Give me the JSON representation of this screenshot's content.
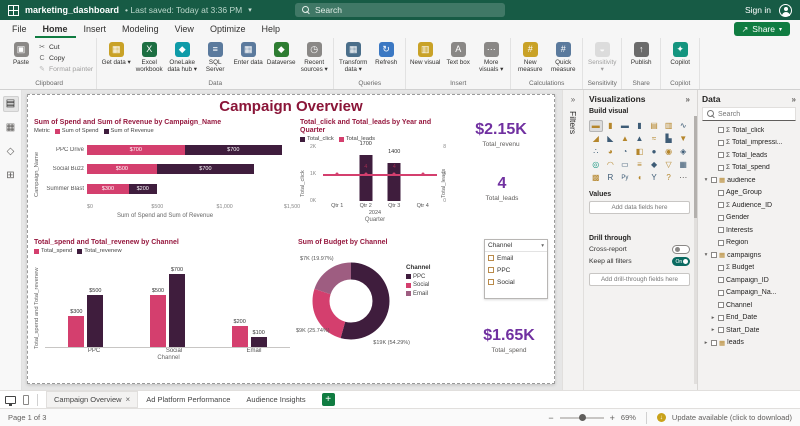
{
  "colors": {
    "titlebar_green": "#175b45",
    "brand_green": "#107c41",
    "accent_dark": "#3f1d3d",
    "accent_pink": "#d43f6e",
    "accent_mauve": "#9e5d81",
    "title_maroon": "#8a1538",
    "chart_title_maroon": "#96193f",
    "card_purple": "#7030a0",
    "toggle_on_teal": "#0a6a61"
  },
  "titlebar": {
    "doc_title": "marketing_dashboard",
    "saved_text": "• Last saved: Today at 3:36 PM",
    "search_placeholder": "Search",
    "sign_in": "Sign in"
  },
  "menubar": {
    "tabs": [
      "File",
      "Home",
      "Insert",
      "Modeling",
      "View",
      "Optimize",
      "Help"
    ],
    "active_tab": "Home",
    "share_label": "Share"
  },
  "ribbon": {
    "groups": [
      {
        "label": "Clipboard",
        "layout": "clipboard",
        "big": {
          "label": "Paste",
          "glyph": "▣",
          "bg": "#8a8886"
        },
        "small": [
          {
            "label": "Cut",
            "glyph": "✂"
          },
          {
            "label": "Copy",
            "glyph": "C"
          },
          {
            "label": "Format painter",
            "glyph": "✎",
            "disabled": true
          }
        ]
      },
      {
        "label": "Data",
        "buttons": [
          {
            "label": "Get data",
            "caret": true,
            "glyph": "▦",
            "bg": "#c9a227"
          },
          {
            "label": "Excel workbook",
            "glyph": "X",
            "bg": "#1d6f42"
          },
          {
            "label": "OneLake data hub",
            "caret": true,
            "glyph": "◆",
            "bg": "#0f9ba8"
          },
          {
            "label": "SQL Server",
            "glyph": "≡",
            "bg": "#5b7a9d"
          },
          {
            "label": "Enter data",
            "glyph": "▦",
            "bg": "#5b7a9d"
          },
          {
            "label": "Dataverse",
            "glyph": "◆",
            "bg": "#2e7d32"
          },
          {
            "label": "Recent sources",
            "caret": true,
            "glyph": "◷",
            "bg": "#8a8886"
          }
        ]
      },
      {
        "label": "Queries",
        "buttons": [
          {
            "label": "Transform data",
            "caret": true,
            "glyph": "▦",
            "bg": "#4a6e8a"
          },
          {
            "label": "Refresh",
            "glyph": "↻",
            "bg": "#3b78c3"
          }
        ]
      },
      {
        "label": "Insert",
        "buttons": [
          {
            "label": "New visual",
            "glyph": "▥",
            "bg": "#c9a227"
          },
          {
            "label": "Text box",
            "glyph": "A",
            "bg": "#8a8886"
          },
          {
            "label": "More visuals",
            "caret": true,
            "glyph": "⋯",
            "bg": "#8a8886"
          }
        ]
      },
      {
        "label": "Calculations",
        "buttons": [
          {
            "label": "New measure",
            "glyph": "#",
            "bg": "#c9a227"
          },
          {
            "label": "Quick measure",
            "glyph": "#",
            "bg": "#5b7a9d"
          }
        ]
      },
      {
        "label": "Sensitivity",
        "buttons": [
          {
            "label": "Sensitivity",
            "caret": true,
            "disabled": true,
            "glyph": "◒",
            "bg": "#bdbdbd"
          }
        ]
      },
      {
        "label": "Share",
        "buttons": [
          {
            "label": "Publish",
            "glyph": "↑",
            "bg": "#6b6b6b"
          }
        ]
      },
      {
        "label": "Copilot",
        "buttons": [
          {
            "label": "Copilot",
            "glyph": "✦",
            "bg": "#14957f"
          }
        ]
      }
    ]
  },
  "left_rail": {
    "items": [
      {
        "name": "report-view",
        "glyph": "▤",
        "active": true
      },
      {
        "name": "table-view",
        "glyph": "▦",
        "active": false
      },
      {
        "name": "model-view",
        "glyph": "◇",
        "active": false
      },
      {
        "name": "dax-query-view",
        "glyph": "⊞",
        "active": false
      }
    ]
  },
  "report": {
    "page_title": "Campaign Overview",
    "cards": [
      {
        "value": "$2.15K",
        "label": "Total_revenu"
      },
      {
        "value": "4",
        "label": "Total_leads"
      },
      {
        "value": "$1.65K",
        "label": "Total_spend"
      }
    ],
    "slicer": {
      "title": "Channel",
      "items": [
        "Email",
        "PPC",
        "Social"
      ]
    }
  },
  "chart_data": [
    {
      "type": "bar",
      "variant": "horizontal-stacked",
      "title": "Sum of Spend and Sum of Revenue by Campaign_Name",
      "legend_title": "Metric",
      "categories": [
        "PPC Drive",
        "Social Buzz",
        "Summer Blast"
      ],
      "series": [
        {
          "name": "Sum of Spend",
          "color": "#d43f6e",
          "values": [
            700,
            500,
            300
          ]
        },
        {
          "name": "Sum of Revenue",
          "color": "#3f1d3d",
          "values": [
            700,
            700,
            200
          ]
        }
      ],
      "value_labels": [
        [
          "$700",
          "$700"
        ],
        [
          "$500",
          "$700"
        ],
        [
          "$300",
          "$200"
        ]
      ],
      "xlabel": "Sum of Spend and Sum of Revenue",
      "ylabel": "Campaign_Name",
      "xlim": [
        0,
        1500
      ],
      "xticks": [
        "$0",
        "$500",
        "$1,000",
        "$1,500"
      ]
    },
    {
      "type": "line",
      "variant": "column-line-combo",
      "title": "Total_click and Total_leads by Year and Quarter",
      "categories": [
        "Qtr 1",
        "Qtr 2",
        "Qtr 3",
        "Qtr 4"
      ],
      "year_label": "2024",
      "xlabel": "Quarter",
      "series": [
        {
          "name": "Total_click",
          "kind": "column",
          "color": "#3f1d3d",
          "values": [
            null,
            1700,
            1400,
            null
          ],
          "labels": [
            "",
            "1700",
            "1400",
            ""
          ]
        },
        {
          "name": "Total_leads",
          "kind": "line",
          "color": "#d43f6e",
          "values": [
            4,
            4,
            4,
            4
          ],
          "labels": [
            "",
            "4",
            "4",
            ""
          ]
        }
      ],
      "ylabel_left": "Total_click",
      "ylabel_right": "Total_leads",
      "ylim_left": [
        0,
        2000
      ],
      "ylim_right": [
        0,
        8
      ],
      "yticks_left": [
        "2K",
        "1K",
        "0K"
      ],
      "yticks_right": [
        "8",
        "4",
        "0"
      ]
    },
    {
      "type": "bar",
      "variant": "column-clustered",
      "title": "Total_spend and Total_revenew by Channel",
      "categories": [
        "PPC",
        "Social",
        "Email"
      ],
      "series": [
        {
          "name": "Total_spend",
          "color": "#d43f6e",
          "values": [
            300,
            500,
            200
          ]
        },
        {
          "name": "Total_revenew",
          "color": "#3f1d3d",
          "values": [
            500,
            700,
            100
          ]
        }
      ],
      "value_labels": [
        [
          "$300",
          "$500"
        ],
        [
          "$500",
          "$700"
        ],
        [
          "$200",
          "$100"
        ]
      ],
      "xlabel": "Channel",
      "ylabel": "Total_spend and Total_revenew",
      "ylim": [
        0,
        800
      ]
    },
    {
      "type": "pie",
      "variant": "donut",
      "title": "Sum of Budget by Channel",
      "legend_title": "Channel",
      "slices": [
        {
          "name": "PPC",
          "value": 19000,
          "label": "$19K",
          "pct": "54.29%",
          "color": "#3f1d3d"
        },
        {
          "name": "Social",
          "value": 9000,
          "label": "$9K",
          "pct": "25.74%",
          "color": "#d43f6e"
        },
        {
          "name": "Email",
          "value": 7000,
          "label": "$7K",
          "pct": "19.97%",
          "color": "#9e5d81"
        }
      ]
    }
  ],
  "filters_panel": {
    "title": "Filters"
  },
  "viz_panel": {
    "title": "Visualizations",
    "build_visual": "Build visual",
    "values_label": "Values",
    "add_fields_placeholder": "Add data fields here",
    "drill_through": "Drill through",
    "cross_report": "Cross-report",
    "keep_filters": "Keep all filters",
    "toggle_on_label": "On",
    "add_drill_placeholder": "Add drill-through fields here",
    "visual_icons": [
      {
        "name": "stacked-bar-chart",
        "glyph": "▬",
        "color": "#b5862b",
        "selected": true
      },
      {
        "name": "stacked-column-chart",
        "glyph": "▮",
        "color": "#b5862b"
      },
      {
        "name": "clustered-bar-chart",
        "glyph": "▬",
        "color": "#3e5c76"
      },
      {
        "name": "clustered-column-chart",
        "glyph": "▮",
        "color": "#3e5c76"
      },
      {
        "name": "100-stacked-bar-chart",
        "glyph": "▤",
        "color": "#b5862b"
      },
      {
        "name": "100-stacked-column-chart",
        "glyph": "▥",
        "color": "#b5862b"
      },
      {
        "name": "line-chart",
        "glyph": "∿",
        "color": "#3e5c76"
      },
      {
        "name": "area-chart",
        "glyph": "◢",
        "color": "#b5862b"
      },
      {
        "name": "stacked-area-chart",
        "glyph": "◣",
        "color": "#3e5c76"
      },
      {
        "name": "line-and-stacked-column-chart",
        "glyph": "▲",
        "color": "#b5862b"
      },
      {
        "name": "line-and-clustered-column-chart",
        "glyph": "▲",
        "color": "#3e5c76"
      },
      {
        "name": "ribbon-chart",
        "glyph": "≈",
        "color": "#b5862b"
      },
      {
        "name": "waterfall-chart",
        "glyph": "▙",
        "color": "#3e5c76"
      },
      {
        "name": "funnel-chart",
        "glyph": "▼",
        "color": "#b5862b"
      },
      {
        "name": "scatter-chart",
        "glyph": "∴",
        "color": "#3e5c76"
      },
      {
        "name": "pie-chart",
        "glyph": "◕",
        "color": "#b5862b"
      },
      {
        "name": "donut-chart",
        "glyph": "◔",
        "color": "#3e5c76"
      },
      {
        "name": "treemap",
        "glyph": "◧",
        "color": "#b5862b"
      },
      {
        "name": "map",
        "glyph": "●",
        "color": "#3e5c76"
      },
      {
        "name": "filled-map",
        "glyph": "◉",
        "color": "#b5862b"
      },
      {
        "name": "shape-map",
        "glyph": "◈",
        "color": "#3e5c76"
      },
      {
        "name": "azure-map",
        "glyph": "◎",
        "color": "#14957f"
      },
      {
        "name": "gauge",
        "glyph": "◠",
        "color": "#b5862b"
      },
      {
        "name": "card",
        "glyph": "▭",
        "color": "#3e5c76"
      },
      {
        "name": "multirow-card",
        "glyph": "≡",
        "color": "#b5862b"
      },
      {
        "name": "kpi",
        "glyph": "◆",
        "color": "#3e5c76"
      },
      {
        "name": "slicer",
        "glyph": "▽",
        "color": "#b5862b"
      },
      {
        "name": "table",
        "glyph": "▦",
        "color": "#3e5c76"
      },
      {
        "name": "matrix",
        "glyph": "▩",
        "color": "#b5862b"
      },
      {
        "name": "r-script-visual",
        "glyph": "R",
        "color": "#3e5c76"
      },
      {
        "name": "python-visual",
        "glyph": "Py",
        "color": "#3e5c76"
      },
      {
        "name": "key-influencers",
        "glyph": "◖",
        "color": "#b5862b"
      },
      {
        "name": "decomposition-tree",
        "glyph": "Y",
        "color": "#3e5c76"
      },
      {
        "name": "qa-visual",
        "glyph": "?",
        "color": "#b5862b"
      },
      {
        "name": "more-visuals",
        "glyph": "⋯",
        "color": "#605e5c"
      }
    ]
  },
  "data_panel": {
    "title": "Data",
    "search_placeholder": "Search",
    "fields": [
      {
        "icon": "sum",
        "label": "Total_click",
        "indent": 1
      },
      {
        "icon": "sum",
        "label": "Total_impressi...",
        "indent": 1
      },
      {
        "icon": "sum",
        "label": "Total_leads",
        "indent": 1
      },
      {
        "icon": "sum",
        "label": "Total_spend",
        "indent": 1
      },
      {
        "expander": "v",
        "icon": "table",
        "label": "audience",
        "indent": 0
      },
      {
        "label": "Age_Group",
        "indent": 1
      },
      {
        "icon": "sum",
        "label": "Audience_ID",
        "indent": 1
      },
      {
        "label": "Gender",
        "indent": 1
      },
      {
        "label": "Interests",
        "indent": 1
      },
      {
        "label": "Region",
        "indent": 1
      },
      {
        "expander": "v",
        "icon": "table",
        "label": "campaigns",
        "indent": 0
      },
      {
        "icon": "sum",
        "label": "Budget",
        "indent": 1
      },
      {
        "label": "Campaign_ID",
        "indent": 1
      },
      {
        "label": "Campaign_Na...",
        "indent": 1
      },
      {
        "label": "Channel",
        "indent": 1
      },
      {
        "expander": ">",
        "label": "End_Date",
        "indent": 1
      },
      {
        "expander": ">",
        "label": "Start_Date",
        "indent": 1
      },
      {
        "expander": ">",
        "icon": "table",
        "label": "leads",
        "indent": 0
      }
    ]
  },
  "page_tabs": {
    "pages": [
      {
        "label": "Campaign Overview",
        "active": true
      },
      {
        "label": "Ad Platform Performance",
        "active": false
      },
      {
        "label": "Audience Insights",
        "active": false
      }
    ],
    "add_label": "+"
  },
  "status_bar": {
    "page_indicator": "Page 1 of 3",
    "zoom": "69%",
    "update_text": "Update available (click to download)"
  }
}
